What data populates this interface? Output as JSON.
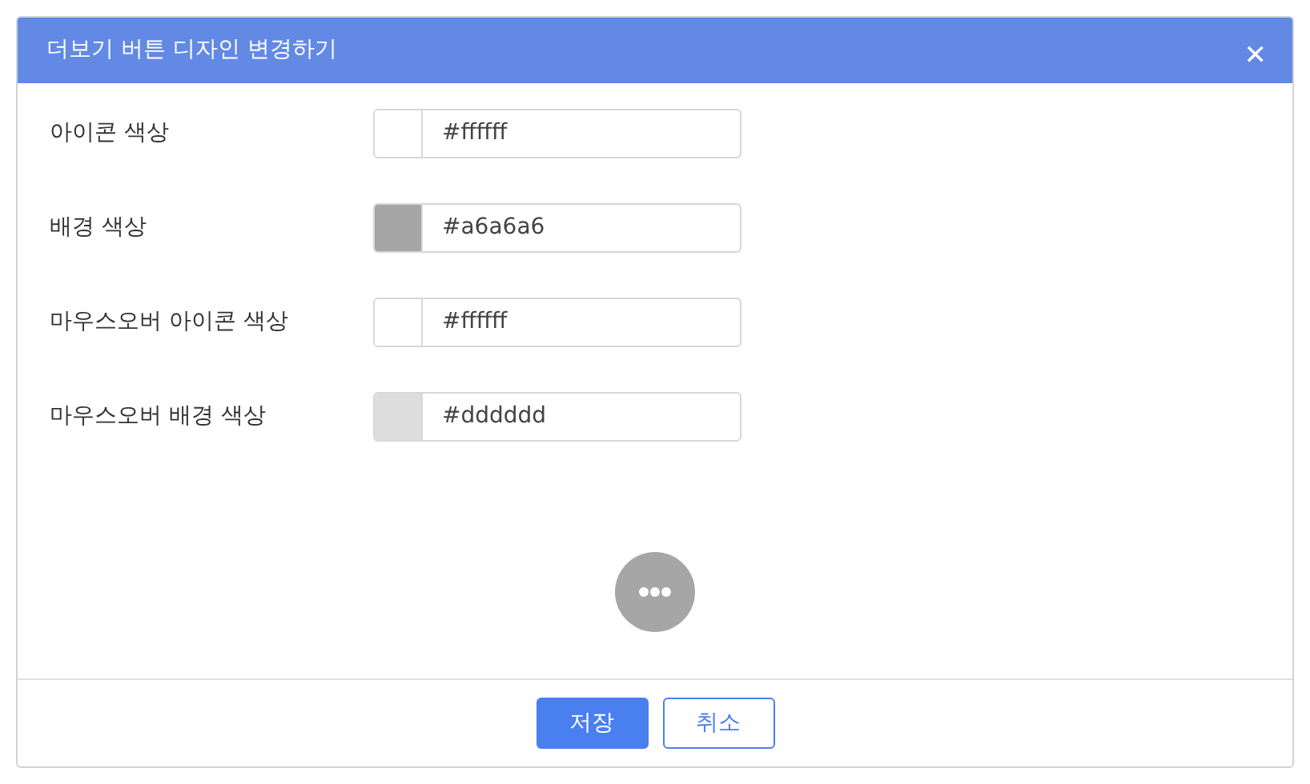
{
  "dialog": {
    "title": "더보기 버튼 디자인 변경하기",
    "close": "✕"
  },
  "fields": [
    {
      "label": "아이콘 색상",
      "value": "#ffffff",
      "color": "#ffffff"
    },
    {
      "label": "배경 색상",
      "value": "#a6a6a6",
      "color": "#a6a6a6"
    },
    {
      "label": "마우스오버 아이콘 색상",
      "value": "#ffffff",
      "color": "#ffffff"
    },
    {
      "label": "마우스오버 배경 색상",
      "value": "#dddddd",
      "color": "#dddddd"
    }
  ],
  "buttons": [
    {
      "label": "저장",
      "kind": "primary"
    },
    {
      "label": "취소",
      "kind": "secondary"
    }
  ]
}
